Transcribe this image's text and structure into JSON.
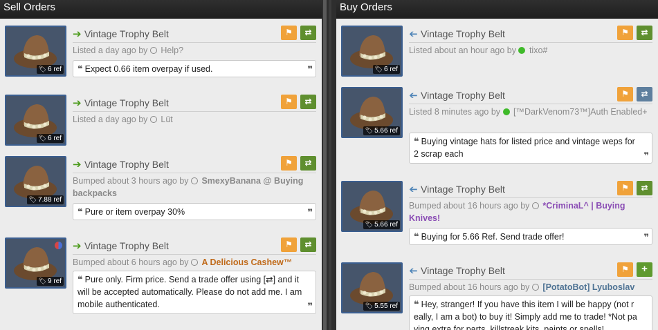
{
  "sell": {
    "header": "Sell Orders",
    "listings": [
      {
        "title": "Vintage Trophy Belt",
        "price": "6 ref",
        "meta_prefix": "Listed a day ago by",
        "user": "Help?",
        "comment": "Expect 0.66 item overpay if used.",
        "flag_icon": "flag-icon",
        "action_icon": "swap-icon"
      },
      {
        "title": "Vintage Trophy Belt",
        "price": "6 ref",
        "meta_prefix": "Listed a day ago by",
        "user": "Lüt"
      },
      {
        "title": "Vintage Trophy Belt",
        "price": "7.88 ref",
        "meta_prefix": "Bumped about 3 hours ago by",
        "user": "SmexyBanana @ Buying backpacks",
        "comment": "Pure or item overpay 30%"
      },
      {
        "title": "Vintage Trophy Belt",
        "price": "9 ref",
        "meta_prefix": "Bumped about 6 hours ago by",
        "user": "A Delicious Cashew™",
        "comment": "Pure only. Firm price. Send a trade offer using [⇄] and it will be accepted automatically. Please do not add me. I am mobile authenticated."
      }
    ]
  },
  "buy": {
    "header": "Buy Orders",
    "listings": [
      {
        "title": "Vintage Trophy Belt",
        "price": "6 ref",
        "meta_prefix": "Listed about an hour ago by",
        "user": "tixo#"
      },
      {
        "title": "Vintage Trophy Belt",
        "price": "5.66 ref",
        "meta_prefix": "Listed 8 minutes ago by",
        "user": "[™DarkVenom73™]Auth Enabled+",
        "comment": "Buying vintage hats for listed price and vintage weps for 2 scrap each"
      },
      {
        "title": "Vintage Trophy Belt",
        "price": "5.66 ref",
        "meta_prefix": "Bumped about 16 hours ago by",
        "user": "*CriminaL^ | Buying Knives!",
        "comment": "Buying for 5.66 Ref. Send trade offer!"
      },
      {
        "title": "Vintage Trophy Belt",
        "price": "5.55 ref",
        "meta_prefix": "Bumped about 16 hours ago by",
        "user": "[PotatoBot] Lyuboslav",
        "comment": "Hey, stranger! If you have this item I will be happy (not r eally, I am a bot) to buy it! Simply add me to trade! *Not pa ying extra for parts, killstreak kits, paints or spells!"
      }
    ]
  },
  "colors": {
    "accent_orange": "#f0a23a",
    "accent_green": "#5f8f2f",
    "frame_blue": "#3b5e8f"
  }
}
